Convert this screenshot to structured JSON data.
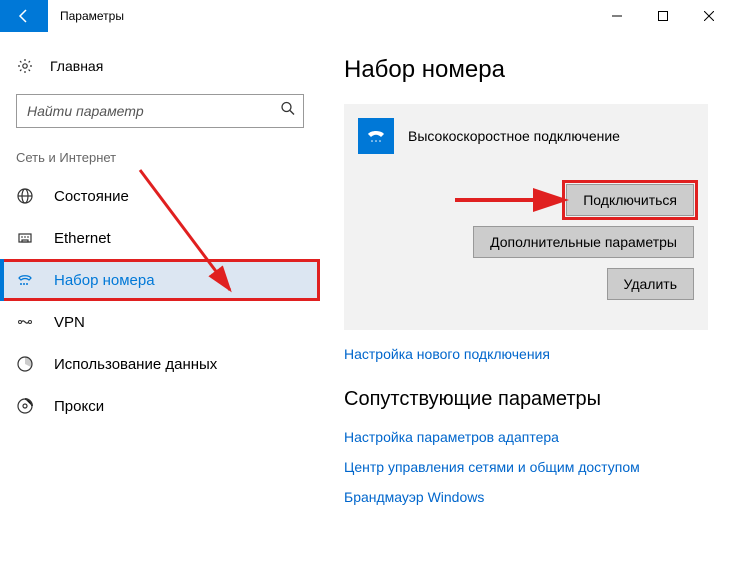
{
  "titlebar": {
    "title": "Параметры"
  },
  "sidebar": {
    "home": "Главная",
    "search_placeholder": "Найти параметр",
    "group": "Сеть и Интернет",
    "items": [
      {
        "label": "Состояние"
      },
      {
        "label": "Ethernet"
      },
      {
        "label": "Набор номера"
      },
      {
        "label": "VPN"
      },
      {
        "label": "Использование данных"
      },
      {
        "label": "Прокси"
      }
    ]
  },
  "main": {
    "title": "Набор номера",
    "connection_name": "Высокоскоростное подключение",
    "btn_connect": "Подключиться",
    "btn_advanced": "Дополнительные параметры",
    "btn_delete": "Удалить",
    "link_new_conn": "Настройка нового подключения",
    "section_related": "Сопутствующие параметры",
    "link_adapter": "Настройка параметров адаптера",
    "link_sharing": "Центр управления сетями и общим доступом",
    "link_firewall": "Брандмауэр Windows"
  }
}
